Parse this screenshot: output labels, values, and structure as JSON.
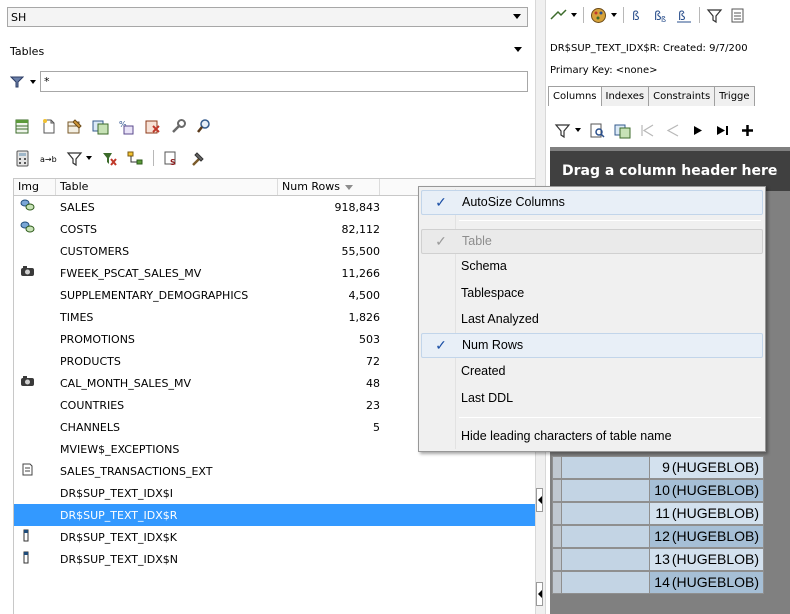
{
  "schema_combo": {
    "value": "SH"
  },
  "type_combo": {
    "value": "Tables"
  },
  "filter": {
    "value": "*"
  },
  "grid": {
    "headers": {
      "img": "Img",
      "table": "Table",
      "num_rows": "Num Rows"
    },
    "rows": [
      {
        "icon": "table-link-icon",
        "name": "SALES",
        "num_rows": "918,843"
      },
      {
        "icon": "table-link-icon",
        "name": "COSTS",
        "num_rows": "82,112"
      },
      {
        "icon": "",
        "name": "CUSTOMERS",
        "num_rows": "55,500"
      },
      {
        "icon": "materialized-view-icon",
        "name": "FWEEK_PSCAT_SALES_MV",
        "num_rows": "11,266"
      },
      {
        "icon": "",
        "name": "SUPPLEMENTARY_DEMOGRAPHICS",
        "num_rows": "4,500"
      },
      {
        "icon": "",
        "name": "TIMES",
        "num_rows": "1,826"
      },
      {
        "icon": "",
        "name": "PROMOTIONS",
        "num_rows": "503"
      },
      {
        "icon": "",
        "name": "PRODUCTS",
        "num_rows": "72"
      },
      {
        "icon": "materialized-view-icon",
        "name": "CAL_MONTH_SALES_MV",
        "num_rows": "48"
      },
      {
        "icon": "",
        "name": "COUNTRIES",
        "num_rows": "23"
      },
      {
        "icon": "",
        "name": "CHANNELS",
        "num_rows": "5"
      },
      {
        "icon": "",
        "name": "MVIEW$_EXCEPTIONS",
        "num_rows": ""
      },
      {
        "icon": "external-table-icon",
        "name": "SALES_TRANSACTIONS_EXT",
        "num_rows": ""
      },
      {
        "icon": "",
        "name": "DR$SUP_TEXT_IDX$I",
        "num_rows": ""
      },
      {
        "icon": "",
        "name": "DR$SUP_TEXT_IDX$R",
        "num_rows": "",
        "selected": true
      },
      {
        "icon": "iot-icon",
        "name": "DR$SUP_TEXT_IDX$K",
        "num_rows": ""
      },
      {
        "icon": "iot-icon",
        "name": "DR$SUP_TEXT_IDX$N",
        "num_rows": ""
      }
    ]
  },
  "right": {
    "info": "DR$SUP_TEXT_IDX$R:  Created: 9/7/200",
    "primary_key": "Primary Key:  <none>",
    "tabs": [
      "Columns",
      "Indexes",
      "Constraints",
      "Trigge"
    ],
    "drag_hint": "Drag a column header here",
    "blob_rows": [
      {
        "num": "9",
        "value": "(HUGEBLOB)"
      },
      {
        "num": "10",
        "value": "(HUGEBLOB)"
      },
      {
        "num": "11",
        "value": "(HUGEBLOB)"
      },
      {
        "num": "12",
        "value": "(HUGEBLOB)"
      },
      {
        "num": "13",
        "value": "(HUGEBLOB)"
      },
      {
        "num": "14",
        "value": "(HUGEBLOB)"
      }
    ]
  },
  "context_menu": {
    "items": [
      {
        "label": "AutoSize Columns",
        "checked": true,
        "disabled": false
      },
      {
        "label": "Table",
        "checked": true,
        "disabled": true
      },
      {
        "label": "Schema",
        "checked": false,
        "disabled": false
      },
      {
        "label": "Tablespace",
        "checked": false,
        "disabled": false
      },
      {
        "label": "Last Analyzed",
        "checked": false,
        "disabled": false
      },
      {
        "label": "Num Rows",
        "checked": true,
        "disabled": false
      },
      {
        "label": "Created",
        "checked": false,
        "disabled": false
      },
      {
        "label": "Last DDL",
        "checked": false,
        "disabled": false
      },
      {
        "label": "Hide leading characters of table name",
        "checked": false,
        "disabled": false
      }
    ],
    "check_glyph": "✓"
  },
  "colors": {
    "selection": "#3399ff",
    "check": "#1b4fa5",
    "dark_grid": "#404040"
  }
}
